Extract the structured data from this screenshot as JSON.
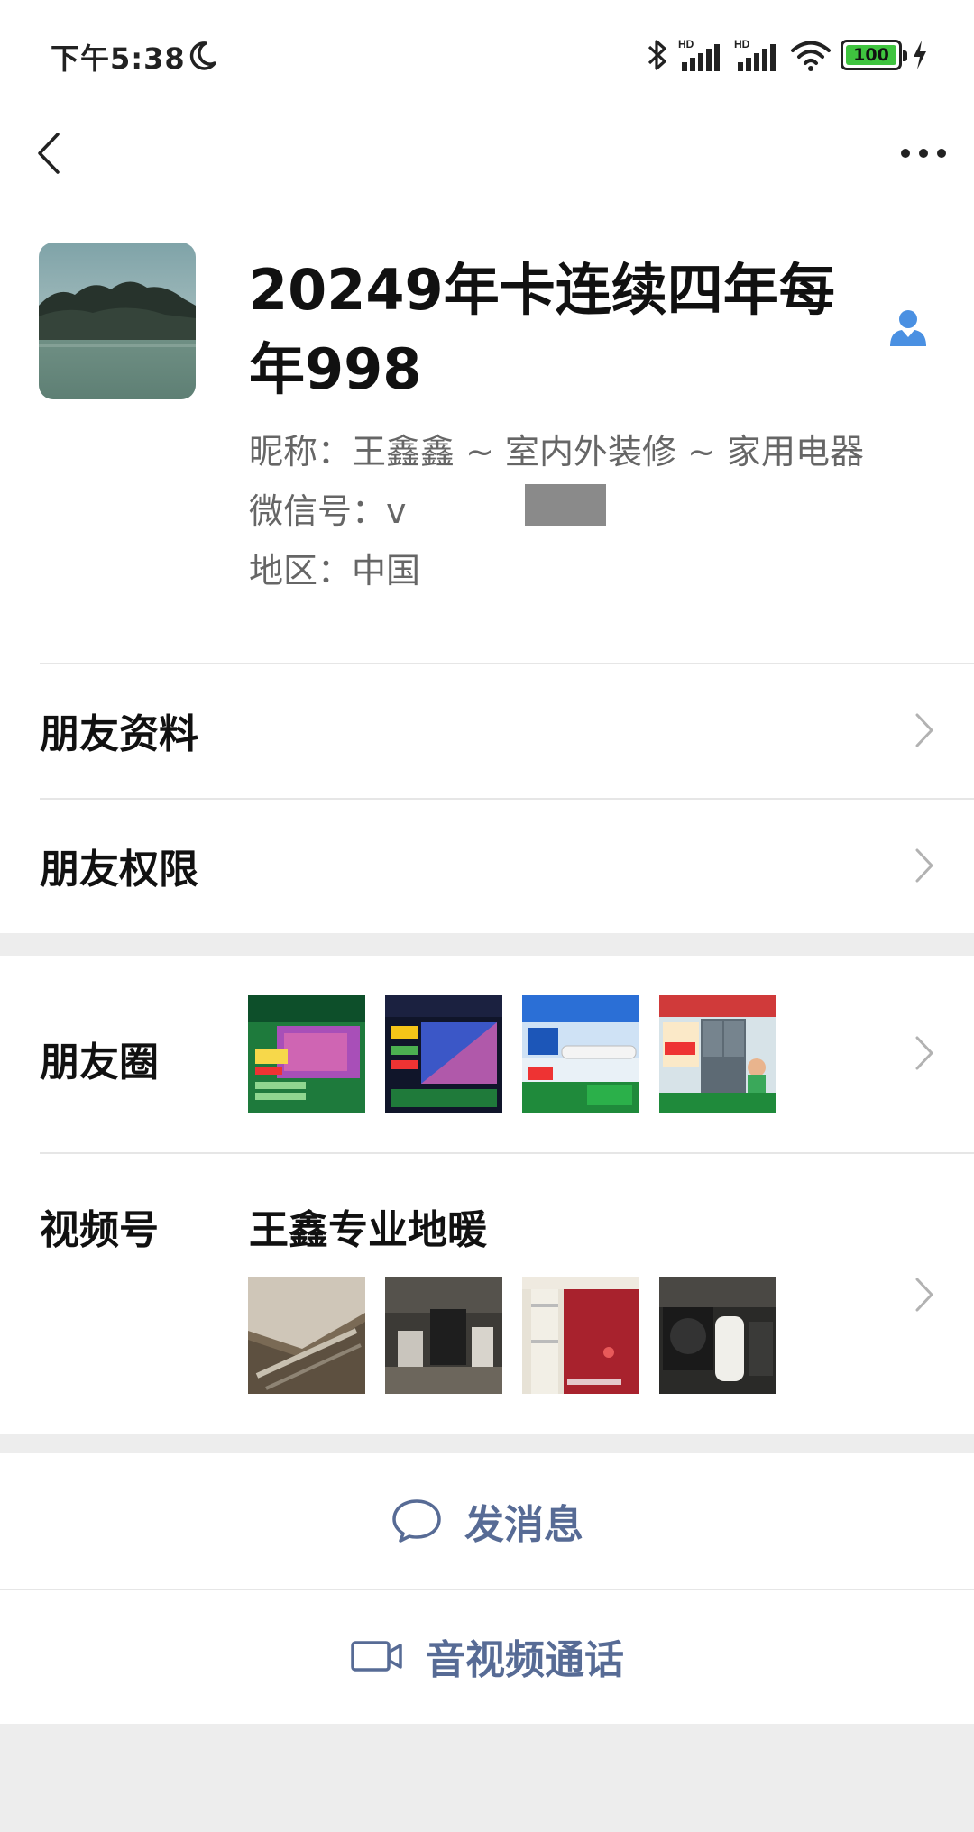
{
  "status_bar": {
    "time": "下午5:38",
    "battery_level": "100",
    "battery_fraction": 1.0,
    "accent_battery": "#3fc43f"
  },
  "nav": {
    "back_icon": "chevron-left-icon",
    "more_icon": "more-dots-icon"
  },
  "profile": {
    "display_name": "20249年卡连续四年每年998",
    "nickname_line": "昵称：王鑫鑫 ~ 室内外装修 ~ 家用电器",
    "wechat_id_line": "微信号：v",
    "region_line": "地区：中国",
    "contact_icon": "person-icon"
  },
  "rows": {
    "friend_info": "朋友资料",
    "friend_permissions": "朋友权限",
    "moments": "朋友圈",
    "channels": "视频号",
    "channel_name": "王鑫专业地暖"
  },
  "actions": {
    "send_message": "发消息",
    "voice_video_call": "音视频通话"
  },
  "colors": {
    "link_blue": "#576b95",
    "separator": "#ededed"
  }
}
